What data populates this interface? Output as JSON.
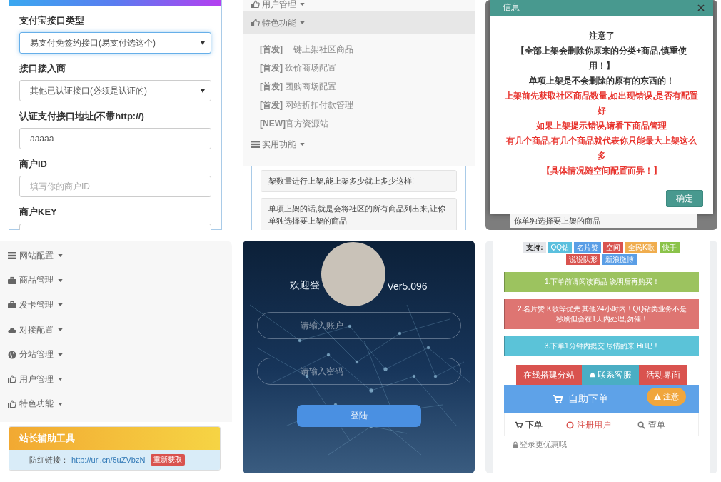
{
  "payment_form": {
    "fields": [
      {
        "label": "支付宝接口类型",
        "kind": "select",
        "value": "易支付免签约接口(易支付选这个)",
        "focused": true
      },
      {
        "label": "接口接入商",
        "kind": "select",
        "value": "其他已认证接口(必须是认证的)",
        "focused": false
      },
      {
        "label": "认证支付接口地址(不带http://)",
        "kind": "input",
        "value": "aaaaa",
        "focused": false
      },
      {
        "label": "商户ID",
        "kind": "input",
        "placeholder": "填写你的商户ID",
        "focused": false
      },
      {
        "label": "商户KEY",
        "kind": "input"
      }
    ]
  },
  "feature_menu": {
    "sections": [
      {
        "label": "用户管理",
        "kind": "thumb",
        "expanded": false
      },
      {
        "label": "特色功能",
        "kind": "thumb",
        "expanded": true,
        "children": [
          {
            "label": "**[首发]** 一键上架社区商品"
          },
          {
            "label": "**[首发]** 砍价商场配置"
          },
          {
            "label": "**[首发]** 团购商场配置"
          },
          {
            "label": "**[首发]** 网站折扣付款管理"
          },
          {
            "label": "**[NEW]**官方资源站"
          }
        ]
      },
      {
        "label": "实用功能",
        "kind": "list",
        "expanded": false
      }
    ],
    "notes": [
      "架数量进行上架,能上架多少就上多少这样!",
      "单项上架的话,就是会将社区的所有商品列出来,让你单独选择要上架的商品"
    ]
  },
  "notice_dialog": {
    "title": "信息",
    "lines": [
      {
        "text": "注意了",
        "kind": "plain"
      },
      {
        "text": "【全部上架会删除你原来的分类+商品,慎重使用！】",
        "kind": "plain"
      },
      {
        "text": "单项上架是不会删除的原有的东西的！",
        "kind": "plain"
      },
      {
        "text": "上架前先获取社区商品数量,如出现错误,是否有配置好",
        "kind": "warning"
      },
      {
        "text": "如果上架提示错误,请看下商品管理",
        "kind": "warning"
      },
      {
        "text": "有几个商品,有几个商品就代表你只能最大上架这么多",
        "kind": "warning"
      },
      {
        "text": "【具体情况随空间配置而异！】",
        "kind": "warning"
      }
    ],
    "button": "确定",
    "background_text": "你单独选择要上架的商品"
  },
  "admin_sidebar": {
    "items": [
      {
        "label": "网站配置",
        "kind": "list"
      },
      {
        "label": "商品管理",
        "kind": "case"
      },
      {
        "label": "发卡管理",
        "kind": "case"
      },
      {
        "label": "对接配置",
        "kind": "cloud"
      },
      {
        "label": "分站管理",
        "kind": "globe"
      },
      {
        "label": "用户管理",
        "kind": "thumb"
      },
      {
        "label": "特色功能",
        "kind": "thumb"
      }
    ],
    "tool_card": {
      "title": "站长辅助工具",
      "label": "防红链接：",
      "link": "http://url.cn/5uZVbzN",
      "button": "重新获取"
    }
  },
  "login_screen": {
    "title_start": "欢迎登",
    "title_end": "Ver5.096",
    "account_placeholder": "请输入账户",
    "password_placeholder": "请输入密码",
    "login_button": "登陆"
  },
  "order_page": {
    "support_label": "支持:",
    "tags": [
      {
        "label": "QQ钻",
        "color": "#5bc0de"
      },
      {
        "label": "名片赞",
        "color": "#5a9ee6"
      },
      {
        "label": "空间",
        "color": "#d9534f"
      },
      {
        "label": "全民K歌",
        "color": "#f0ad4e"
      },
      {
        "label": "快手",
        "color": "#8bc34a"
      },
      {
        "label": "说说队形",
        "color": "#d9534f"
      },
      {
        "label": "新浪微博",
        "color": "#5a9ee6"
      }
    ],
    "notices": [
      {
        "text": "1.下单前请阅读商品 说明后再购买！",
        "color": "#9cc35f"
      },
      {
        "text": "2.名片赞 K歌等优先 其他24小时内！QQ钻类业务不是秒刷但会在1天内处理,勿催！",
        "color": "#de7572"
      },
      {
        "text": "3.下单1分钟内提交 尽情的来 Hi 吧！",
        "color": "#5bc3d8"
      }
    ],
    "buttons": [
      {
        "label": "在线搭建分站",
        "color": "#d9534f",
        "kind": "plain"
      },
      {
        "label": "联系客服",
        "color": "#4aaec4",
        "kind": "contact"
      },
      {
        "label": "活动界面",
        "color": "#d9534f",
        "kind": "plain"
      }
    ],
    "header": "自助下单",
    "attention_badge": "注意",
    "tabs": [
      {
        "label": "下单",
        "kind": "cart",
        "selected": true
      },
      {
        "label": "注册用户",
        "kind": "register",
        "selected": false
      },
      {
        "label": "查单",
        "kind": "search",
        "selected": false
      }
    ],
    "login_hint": "登录更优惠哦"
  }
}
